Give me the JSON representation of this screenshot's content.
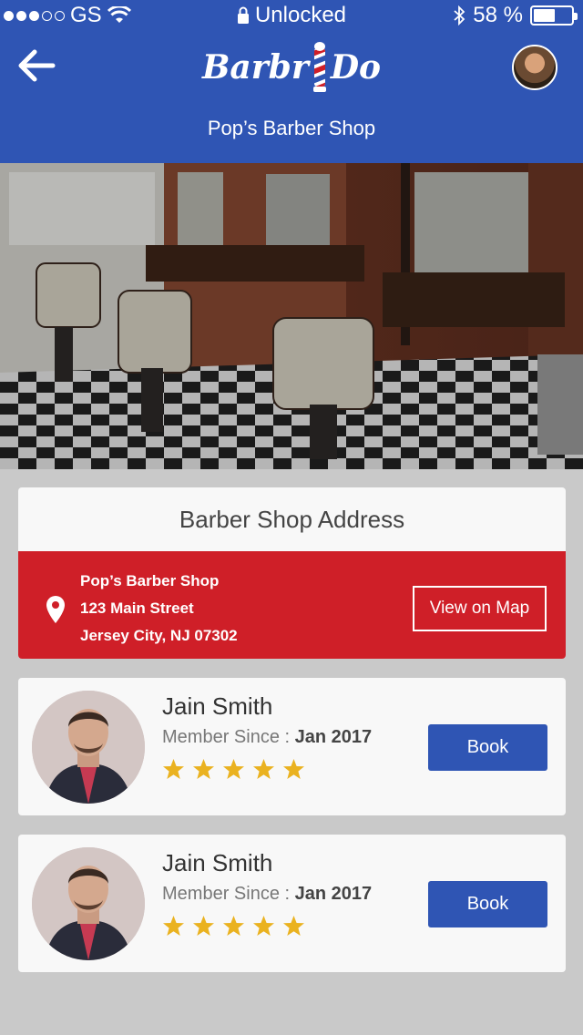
{
  "status_bar": {
    "carrier": "GS",
    "center": "Unlocked",
    "battery": "58 %",
    "battery_level": 0.58
  },
  "header": {
    "logo_left": "Barbr",
    "logo_right": "Do",
    "title": "Pop’s Barber Shop"
  },
  "address_card": {
    "heading": "Barber Shop Address",
    "line1": "Pop’s Barber Shop",
    "line2": "123 Main Street",
    "line3": "Jersey City, NJ 07302",
    "map_button": "View on Map"
  },
  "barbers": [
    {
      "name": "Jain Smith",
      "member_label": "Member Since : ",
      "member_date": "Jan 2017",
      "rating": 5,
      "book_label": "Book"
    },
    {
      "name": "Jain Smith",
      "member_label": "Member Since : ",
      "member_date": "Jan 2017",
      "rating": 5,
      "book_label": "Book"
    }
  ],
  "colors": {
    "primary": "#2f55b4",
    "accent_red": "#cf1f28",
    "star": "#eab220",
    "background": "#c9c9c9"
  }
}
